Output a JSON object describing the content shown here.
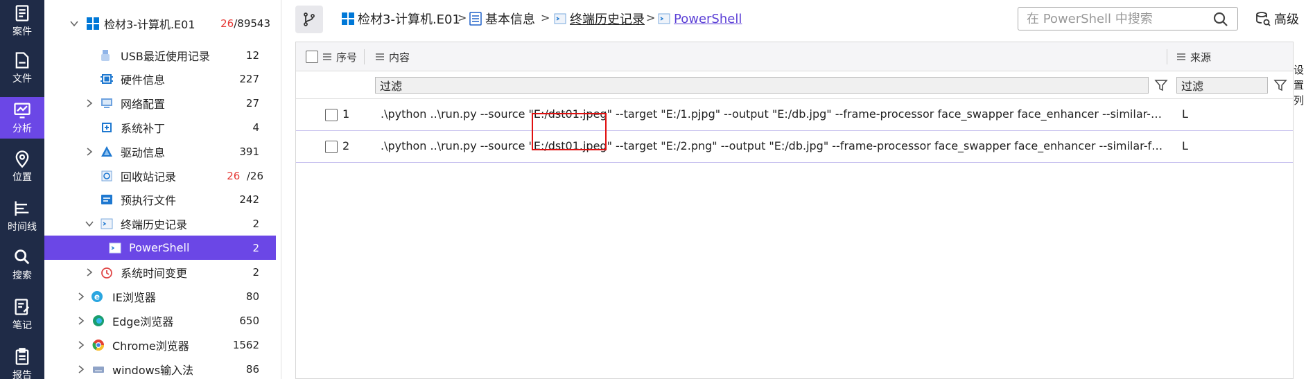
{
  "rail": [
    {
      "label": "案件",
      "icon": "case-icon"
    },
    {
      "label": "文件",
      "icon": "file-icon"
    },
    {
      "label": "分析",
      "icon": "analysis-icon",
      "active": true
    },
    {
      "label": "位置",
      "icon": "location-icon"
    },
    {
      "label": "时间线",
      "icon": "timeline-icon"
    },
    {
      "label": "搜索",
      "icon": "search-icon"
    },
    {
      "label": "笔记",
      "icon": "note-icon"
    },
    {
      "label": "报告",
      "icon": "report-icon"
    }
  ],
  "tree": {
    "root": {
      "label": "检材3-计算机.E01",
      "count_red": "26",
      "count_total": "/89543"
    },
    "items": [
      {
        "label": "USB最近使用记录",
        "count": "12",
        "icon": "usb-icon"
      },
      {
        "label": "硬件信息",
        "count": "227",
        "icon": "chip-icon"
      },
      {
        "label": "网络配置",
        "count": "27",
        "icon": "network-icon"
      },
      {
        "label": "系统补丁",
        "count": "4",
        "icon": "patch-icon"
      },
      {
        "label": "驱动信息",
        "count": "391",
        "icon": "driver-icon"
      },
      {
        "label": "回收站记录",
        "count_red": "26",
        "count": "/26",
        "icon": "recycle-bin-icon"
      },
      {
        "label": "预执行文件",
        "count": "242",
        "icon": "prefetch-icon"
      },
      {
        "label": "终端历史记录",
        "count": "2",
        "icon": "terminal-icon"
      },
      {
        "label": "PowerShell",
        "count": "2",
        "icon": "powershell-icon"
      },
      {
        "label": "系统时间变更",
        "count": "2",
        "icon": "clock-icon"
      },
      {
        "label": "IE浏览器",
        "count": "80",
        "icon": "ie-icon"
      },
      {
        "label": "Edge浏览器",
        "count": "650",
        "icon": "edge-icon"
      },
      {
        "label": "Chrome浏览器",
        "count": "1562",
        "icon": "chrome-icon"
      },
      {
        "label": "windows输入法",
        "count": "86",
        "icon": "keyboard-icon"
      }
    ]
  },
  "breadcrumb": {
    "items": [
      "检材3-计算机.E01",
      "基本信息",
      "终端历史记录",
      "PowerShell"
    ],
    "separator": ">"
  },
  "search": {
    "placeholder": "在 PowerShell 中搜索"
  },
  "advanced_label": "高级",
  "grid": {
    "columns": {
      "index": "序号",
      "content": "内容",
      "source": "来源"
    },
    "filter_placeholder": "过滤",
    "rows": [
      {
        "index": "1",
        "content": ".\\python ..\\run.py --source \"E:/dst01.jpeg\" --target \"E:/1.pjpg\" --output \"E:/db.jpg\" --frame-processor face_swapper face_enhancer --similar-face-...",
        "source": "L"
      },
      {
        "index": "2",
        "content": ".\\python ..\\run.py --source \"E:/dst01.jpeg\" --target \"E:/2.png\" --output \"E:/db.jpg\" --frame-processor face_swapper face_enhancer --similar-face-...",
        "source": "L"
      }
    ]
  },
  "side_panel_label": "设置列",
  "colors": {
    "rail_bg": "#1f2b47",
    "accent": "#6b47e6",
    "highlight_box": "#e01010"
  }
}
